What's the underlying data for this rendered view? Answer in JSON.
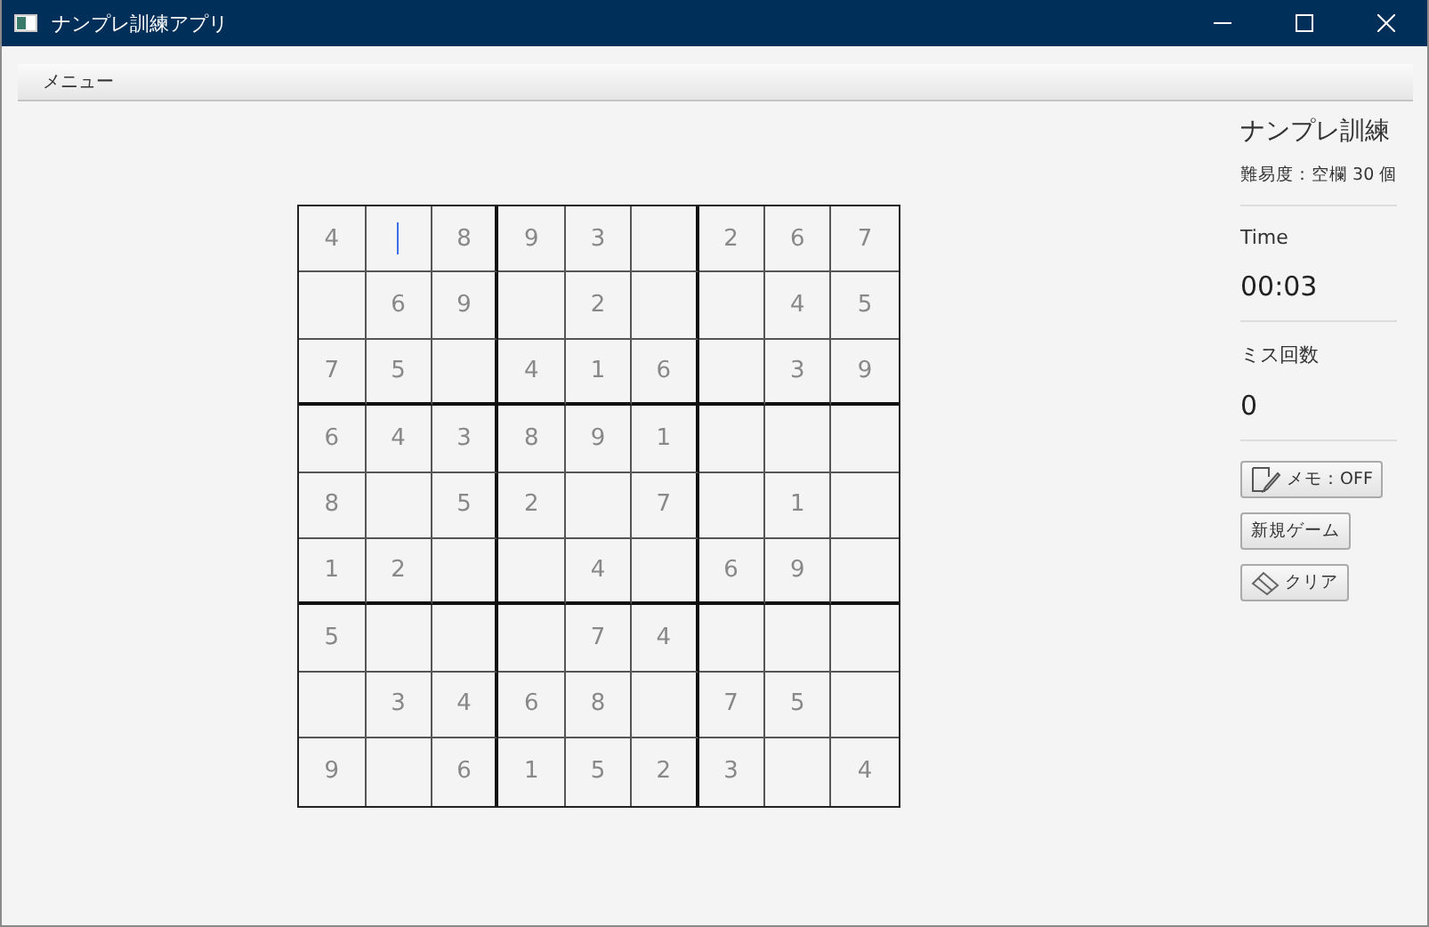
{
  "window": {
    "title": "ナンプレ訓練アプリ"
  },
  "menu": [
    "メニュー"
  ],
  "grid": [
    [
      {
        "value": "4",
        "focused": false
      },
      {
        "focused": true
      },
      {
        "value": "8",
        "focused": false
      },
      {
        "value": "9",
        "focused": false
      },
      {
        "value": "3",
        "focused": false
      },
      {
        "focused": false
      },
      {
        "value": "2",
        "focused": false
      },
      {
        "value": "6",
        "focused": false
      },
      {
        "value": "7",
        "focused": false
      }
    ],
    [
      {
        "focused": false
      },
      {
        "value": "6",
        "focused": false
      },
      {
        "value": "9",
        "focused": false
      },
      {
        "focused": false
      },
      {
        "value": "2",
        "focused": false
      },
      {
        "focused": false
      },
      {
        "focused": false
      },
      {
        "value": "4",
        "focused": false
      },
      {
        "value": "5",
        "focused": false
      }
    ],
    [
      {
        "value": "7",
        "focused": false
      },
      {
        "value": "5",
        "focused": false
      },
      {
        "focused": false
      },
      {
        "value": "4",
        "focused": false
      },
      {
        "value": "1",
        "focused": false
      },
      {
        "value": "6",
        "focused": false
      },
      {
        "focused": false
      },
      {
        "value": "3",
        "focused": false
      },
      {
        "value": "9",
        "focused": false
      }
    ],
    [
      {
        "value": "6",
        "focused": false
      },
      {
        "value": "4",
        "focused": false
      },
      {
        "value": "3",
        "focused": false
      },
      {
        "value": "8",
        "focused": false
      },
      {
        "value": "9",
        "focused": false
      },
      {
        "value": "1",
        "focused": false
      },
      {
        "focused": false
      },
      {
        "focused": false
      },
      {
        "focused": false
      }
    ],
    [
      {
        "value": "8",
        "focused": false
      },
      {
        "focused": false
      },
      {
        "value": "5",
        "focused": false
      },
      {
        "value": "2",
        "focused": false
      },
      {
        "focused": false
      },
      {
        "value": "7",
        "focused": false
      },
      {
        "focused": false
      },
      {
        "value": "1",
        "focused": false
      },
      {
        "focused": false
      }
    ],
    [
      {
        "value": "1",
        "focused": false
      },
      {
        "value": "2",
        "focused": false
      },
      {
        "focused": false
      },
      {
        "focused": false
      },
      {
        "value": "4",
        "focused": false
      },
      {
        "focused": false
      },
      {
        "value": "6",
        "focused": false
      },
      {
        "value": "9",
        "focused": false
      },
      {
        "focused": false
      }
    ],
    [
      {
        "value": "5",
        "focused": false
      },
      {
        "focused": false
      },
      {
        "focused": false
      },
      {
        "focused": false
      },
      {
        "value": "7",
        "focused": false
      },
      {
        "value": "4",
        "focused": false
      },
      {
        "focused": false
      },
      {
        "focused": false
      },
      {
        "focused": false
      }
    ],
    [
      {
        "focused": false
      },
      {
        "value": "3",
        "focused": false
      },
      {
        "value": "4",
        "focused": false
      },
      {
        "value": "6",
        "focused": false
      },
      {
        "value": "8",
        "focused": false
      },
      {
        "focused": false
      },
      {
        "value": "7",
        "focused": false
      },
      {
        "value": "5",
        "focused": false
      },
      {
        "focused": false
      }
    ],
    [
      {
        "value": "9",
        "focused": false
      },
      {
        "focused": false
      },
      {
        "value": "6",
        "focused": false
      },
      {
        "value": "1",
        "focused": false
      },
      {
        "value": "5",
        "focused": false
      },
      {
        "value": "2",
        "focused": false
      },
      {
        "value": "3",
        "focused": false
      },
      {
        "focused": false
      },
      {
        "value": "4",
        "focused": false
      }
    ]
  ],
  "panel": {
    "title": "ナンプレ訓練",
    "difficulty": "難易度：空欄 30 個",
    "time_label": "Time",
    "time": "00:03",
    "miss_label": "ミス回数",
    "miss": "0",
    "buttons": [
      {
        "kind": "memo",
        "label": "メモ：OFF"
      },
      {
        "kind": "plain",
        "label": "新規ゲーム"
      },
      {
        "kind": "clear",
        "label": "クリア"
      }
    ]
  }
}
